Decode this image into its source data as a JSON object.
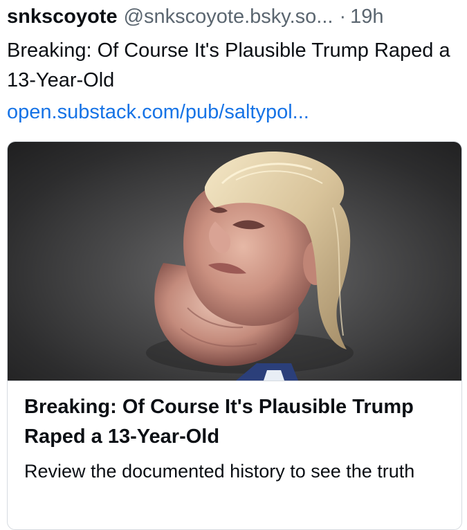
{
  "post": {
    "display_name": "snkscoyote",
    "handle": "@snkscoyote.bsky.so...",
    "separator": "·",
    "time": "19h",
    "text": "Breaking: Of Course It's Plausible Trump Raped a 13-Year-Old",
    "link": "open.substack.com/pub/saltypol..."
  },
  "card": {
    "image_subject": "caricature-portrait",
    "title": "Breaking: Of Course It's Plausible Trump Raped a 13-Year-Old",
    "description": "Review the documented history to see the truth"
  },
  "colors": {
    "link": "#1673e6",
    "meta": "#5b6670",
    "border": "#d6dbe0"
  }
}
